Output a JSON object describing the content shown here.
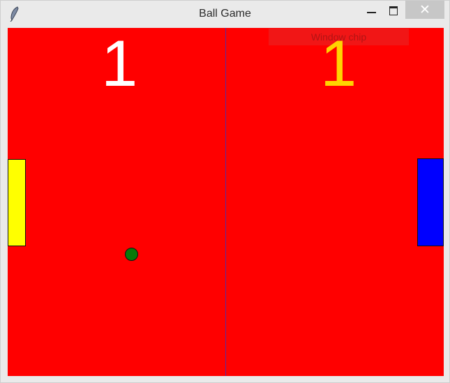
{
  "window": {
    "title": "Ball Game",
    "app_icon": "feather-icon",
    "controls": {
      "minimize_icon": "minimize-icon",
      "maximize_icon": "maximize-icon",
      "close_label": "✕"
    }
  },
  "game": {
    "score_left": "1",
    "score_right": "1",
    "overlay_chip_text": "Window chip",
    "colors": {
      "court": "#ff0000",
      "centerline": "#5a2aa0",
      "score_left": "#ffffff",
      "score_right": "#ffd400",
      "paddle_left": "#ffff00",
      "paddle_right": "#0000ff",
      "ball": "#0a7a0a"
    }
  }
}
